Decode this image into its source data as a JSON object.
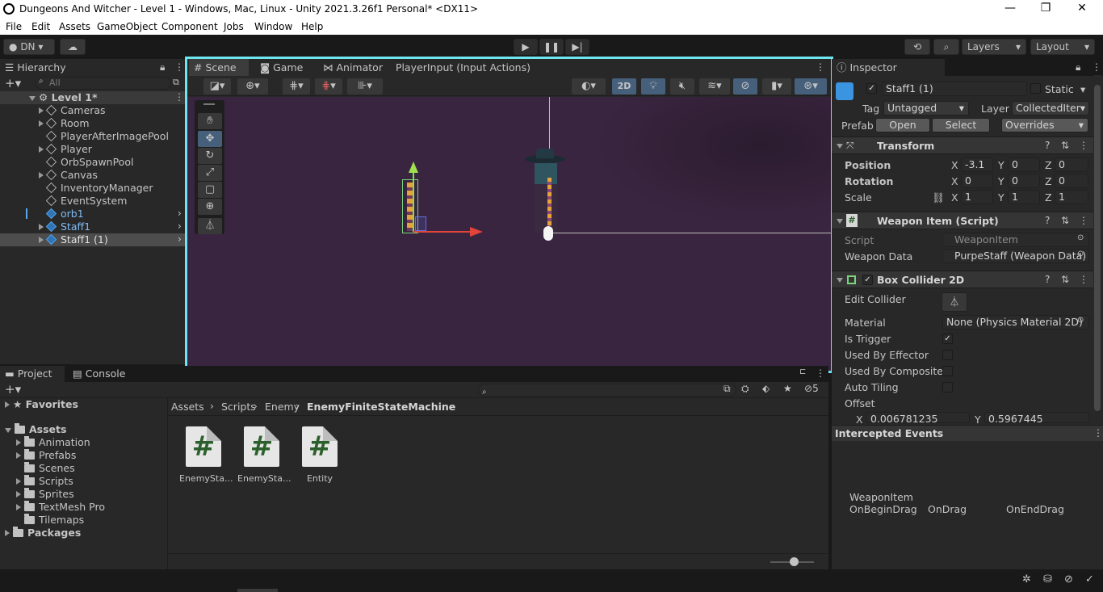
{
  "window": {
    "title": "Dungeons And Witcher - Level 1 - Windows, Mac, Linux - Unity 2021.3.26f1 Personal* <DX11>"
  },
  "menu": [
    "File",
    "Edit",
    "Assets",
    "GameObject",
    "Component",
    "Jobs",
    "Window",
    "Help"
  ],
  "toolbar": {
    "account": "DN",
    "layers": "Layers",
    "layout": "Layout"
  },
  "hierarchy": {
    "tab": "Hierarchy",
    "search_placeholder": "All",
    "scene": "Level 1*",
    "items": [
      {
        "label": "Cameras",
        "expandable": true,
        "selected": false,
        "prefab": false
      },
      {
        "label": "Room",
        "expandable": true,
        "selected": false,
        "prefab": false
      },
      {
        "label": "PlayerAfterImagePool",
        "expandable": false,
        "selected": false,
        "prefab": false
      },
      {
        "label": "Player",
        "expandable": true,
        "selected": false,
        "prefab": false
      },
      {
        "label": "OrbSpawnPool",
        "expandable": false,
        "selected": false,
        "prefab": false
      },
      {
        "label": "Canvas",
        "expandable": true,
        "selected": false,
        "prefab": false
      },
      {
        "label": "InventoryManager",
        "expandable": false,
        "selected": false,
        "prefab": false
      },
      {
        "label": "EventSystem",
        "expandable": false,
        "selected": false,
        "prefab": false
      },
      {
        "label": "orb1",
        "expandable": false,
        "selected": false,
        "prefab": true
      },
      {
        "label": "Staff1",
        "expandable": true,
        "selected": false,
        "prefab": true
      },
      {
        "label": "Staff1 (1)",
        "expandable": true,
        "selected": true,
        "prefab": true
      }
    ]
  },
  "scene": {
    "tabs": [
      "Scene",
      "Game",
      "Animator",
      "PlayerInput (Input Actions)"
    ],
    "mode_2d": "2D"
  },
  "project": {
    "tabs": [
      "Project",
      "Console"
    ],
    "favorites": "Favorites",
    "assets": "Assets",
    "folders": [
      "Animation",
      "Prefabs",
      "Scenes",
      "Scripts",
      "Sprites",
      "TextMesh Pro",
      "Tilemaps"
    ],
    "packages": "Packages",
    "breadcrumb": [
      "Assets",
      "Scripts",
      "Enemy",
      "EnemyFiniteStateMachine"
    ],
    "files": [
      "EnemySta...",
      "EnemySta...",
      "Entity"
    ],
    "hidden_count": "5"
  },
  "inspector": {
    "tab": "Inspector",
    "object_name": "Staff1 (1)",
    "static": "Static",
    "tag_label": "Tag",
    "tag": "Untagged",
    "layer_label": "Layer",
    "layer": "CollectedItem",
    "prefab_label": "Prefab",
    "open": "Open",
    "select": "Select",
    "overrides": "Overrides",
    "transform": {
      "title": "Transform",
      "position": "Position",
      "rotation": "Rotation",
      "scale": "Scale",
      "px": "-3.1",
      "py": "0",
      "pz": "0",
      "rx": "0",
      "ry": "0",
      "rz": "0",
      "sx": "1",
      "sy": "1",
      "sz": "1"
    },
    "weapon": {
      "title": "Weapon Item (Script)",
      "script_label": "Script",
      "script": "WeaponItem",
      "data_label": "Weapon Data",
      "data": "PurpeStaff (Weapon Data)"
    },
    "collider": {
      "title": "Box Collider 2D",
      "edit": "Edit Collider",
      "material_label": "Material",
      "material": "None (Physics Material 2D)",
      "is_trigger": "Is Trigger",
      "by_effector": "Used By Effector",
      "by_composite": "Used By Composite",
      "auto_tiling": "Auto Tiling",
      "offset": "Offset",
      "ox": "0.006781235",
      "oy": "0.5967445"
    },
    "events": {
      "title": "Intercepted Events",
      "component": "WeaponItem",
      "list": [
        "OnBeginDrag",
        "OnDrag",
        "OnEndDrag"
      ]
    }
  },
  "axis": {
    "x": "X",
    "y": "Y",
    "z": "Z"
  },
  "colors": {
    "scene_bg": "#3a2540",
    "highlight": "#6ee6f0",
    "selected_row": "#4d4d4d",
    "blue_text": "#5aa7ef"
  }
}
